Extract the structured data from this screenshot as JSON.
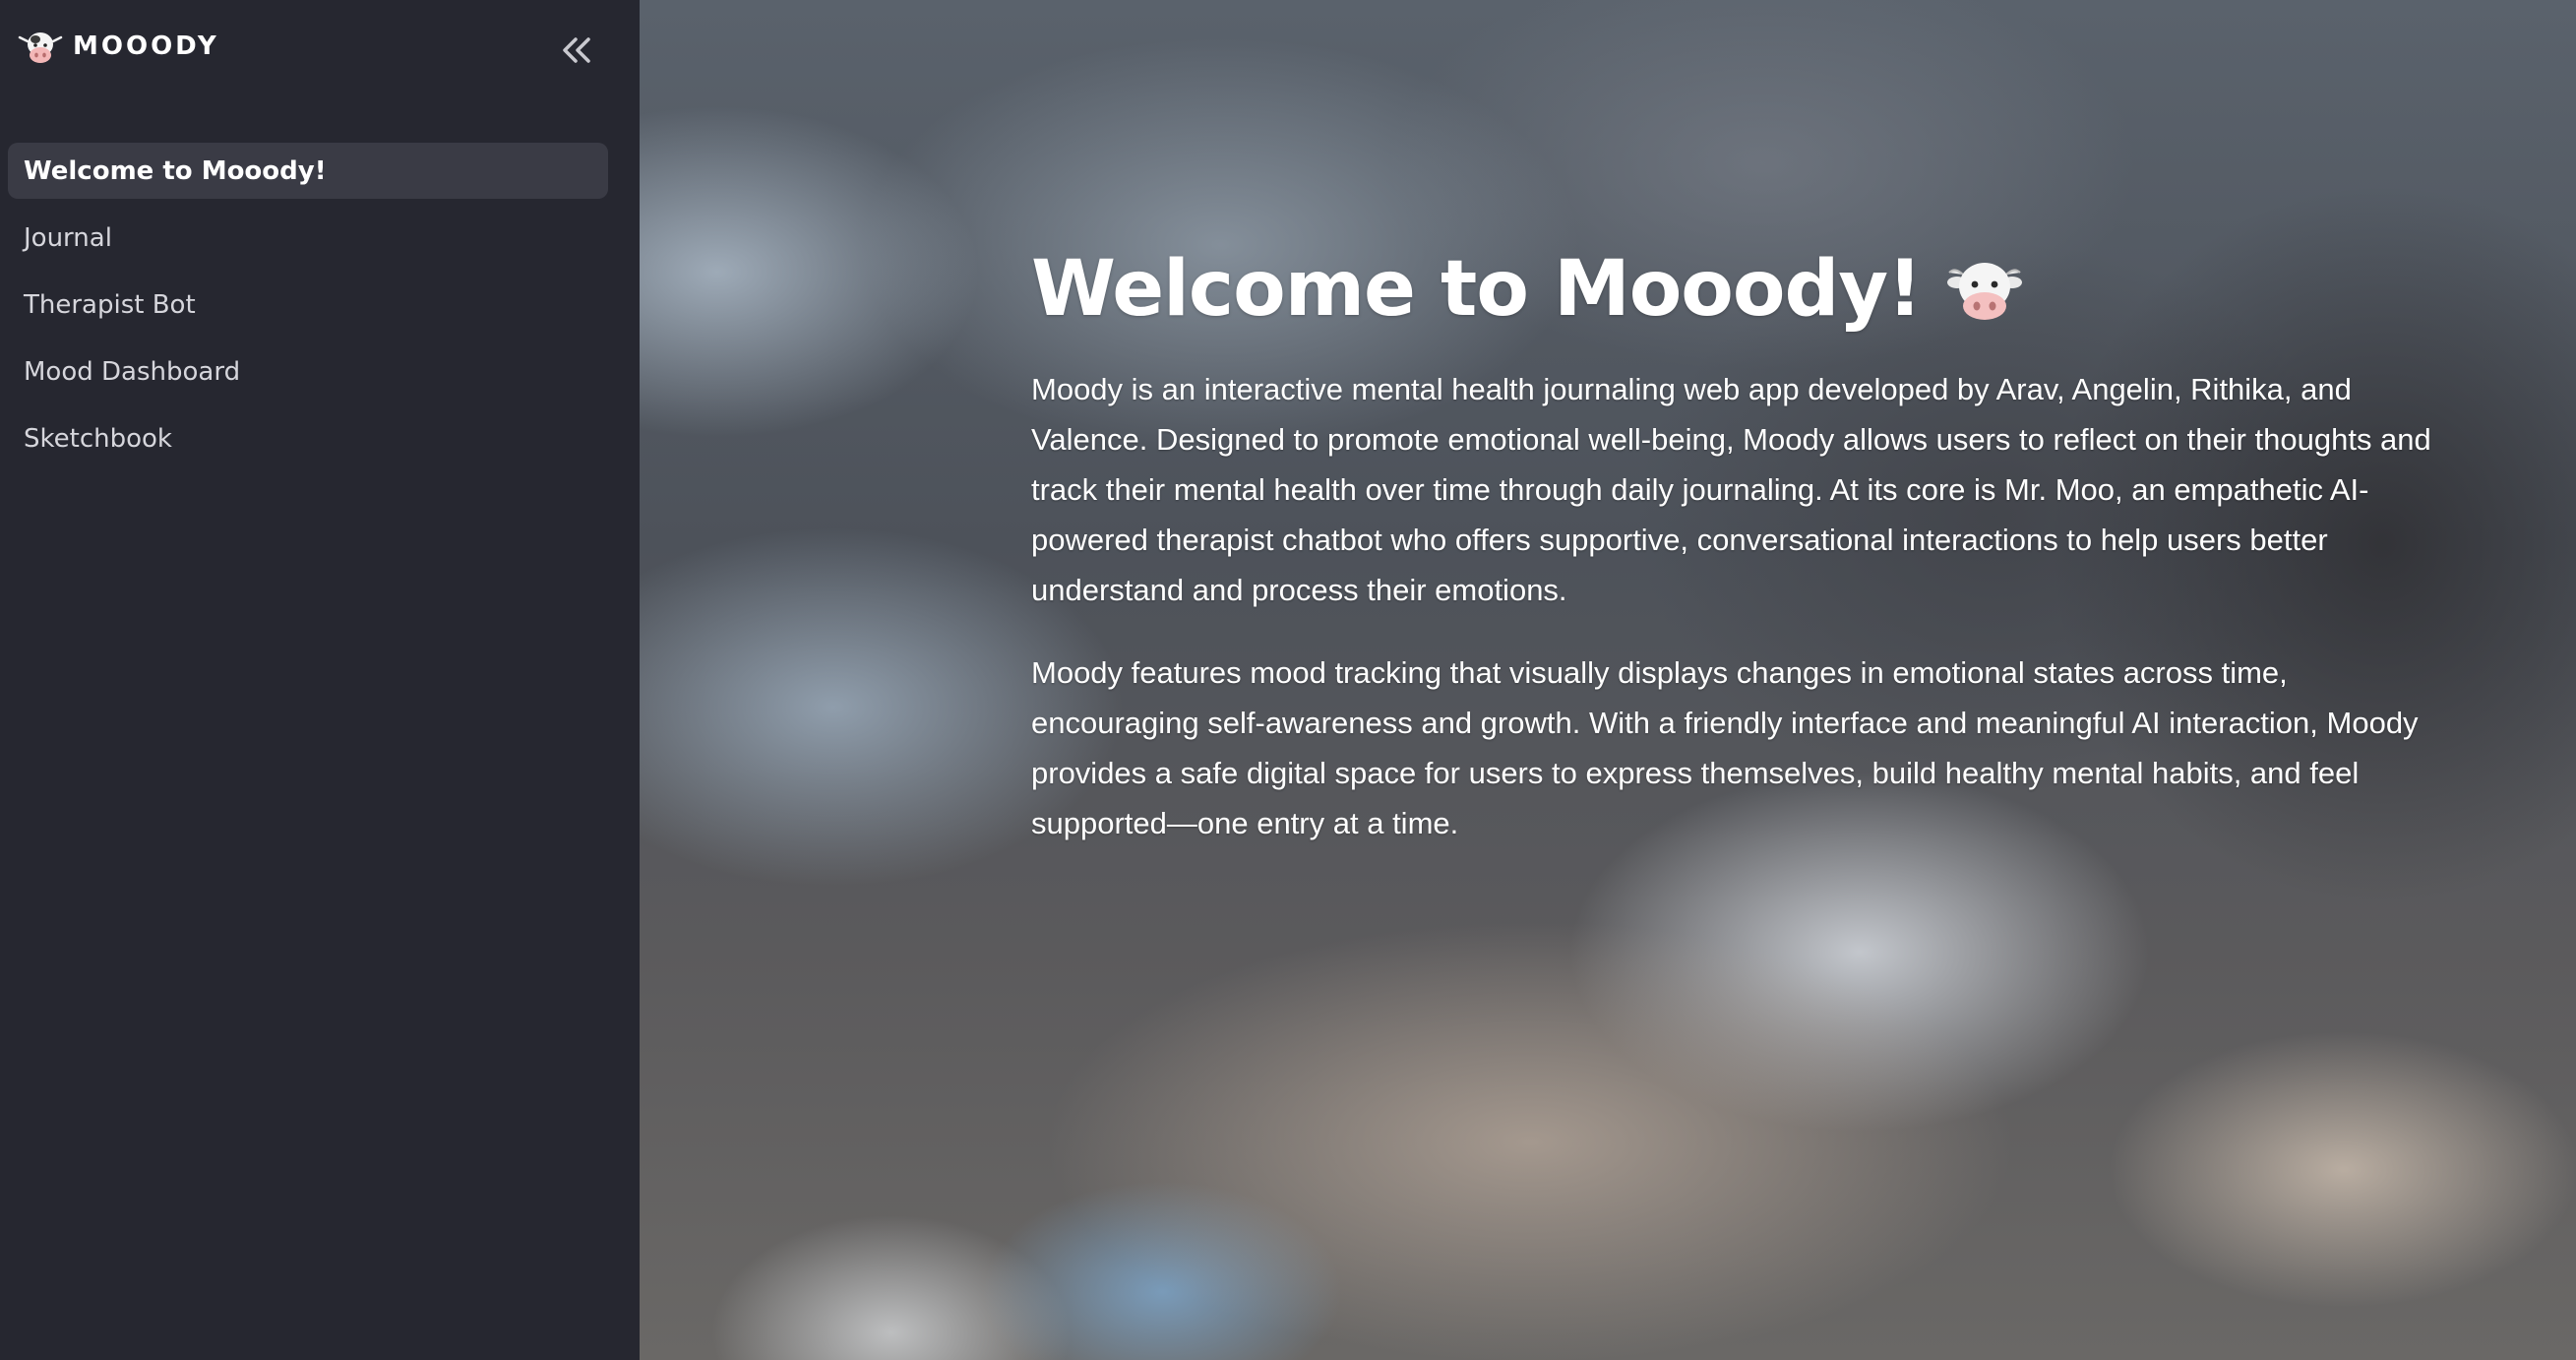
{
  "sidebar": {
    "logo_text": "MOOODY",
    "items": [
      {
        "label": "Welcome to Mooody!",
        "active": true
      },
      {
        "label": "Journal",
        "active": false
      },
      {
        "label": "Therapist Bot",
        "active": false
      },
      {
        "label": "Mood Dashboard",
        "active": false
      },
      {
        "label": "Sketchbook",
        "active": false
      }
    ]
  },
  "main": {
    "title": "Welcome to Mooody!",
    "paragraphs": [
      "Moody is an interactive mental health journaling web app developed by Arav, Angelin, Rithika, and Valence. Designed to promote emotional well-being, Moody allows users to reflect on their thoughts and track their mental health over time through daily journaling. At its core is Mr. Moo, an empathetic AI-powered therapist chatbot who offers supportive, conversational interactions to help users better understand and process their emotions.",
      "Moody features mood tracking that visually displays changes in emotional states across time, encouraging self-awareness and growth. With a friendly interface and meaningful AI interaction, Moody provides a safe digital space for users to express themselves, build healthy mental habits, and feel supported—one entry at a time."
    ]
  },
  "icons": {
    "logo": "cow-face-icon",
    "collapse": "double-chevron-left-icon",
    "title_emoji": "cow-face-icon"
  },
  "colors": {
    "sidebar_bg": "#262730",
    "active_item_bg": "#3a3b45",
    "text_primary": "#ffffff",
    "text_nav": "#d6d6dc"
  }
}
